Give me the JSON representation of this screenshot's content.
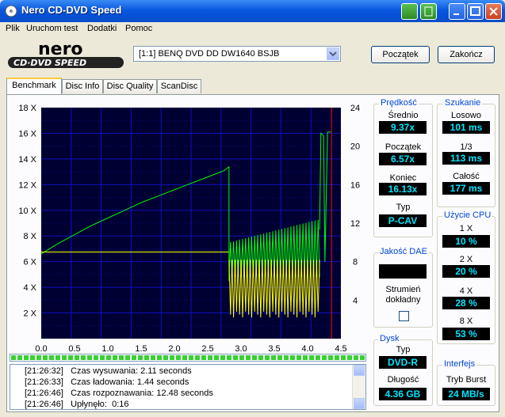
{
  "window": {
    "title": "Nero CD-DVD Speed"
  },
  "menu": [
    "Plik",
    "Uruchom test",
    "Dodatki",
    "Pomoc"
  ],
  "logo": {
    "brand": "nero",
    "sub": "CD·DVD SPEED"
  },
  "drive": {
    "selected": "[1:1]  BENQ DVD DD DW1640 BSJB"
  },
  "buttons": {
    "start": "Początek",
    "finish": "Zakończ"
  },
  "tabs": [
    "Benchmark",
    "Disc Info",
    "Disc Quality",
    "ScanDisc"
  ],
  "colors": {
    "plot_bg": "#000033",
    "grid": "#1010c0",
    "speed": "#00ff00",
    "rpm": "#ffff00",
    "marker": "#ff0000",
    "value_text": "#00e5ff"
  },
  "chart_data": {
    "type": "line",
    "x_ticks": [
      "0.0",
      "0.5",
      "1.0",
      "1.5",
      "2.0",
      "2.5",
      "3.0",
      "3.5",
      "4.0",
      "4.5"
    ],
    "y_left_ticks": [
      "18 X",
      "16 X",
      "14 X",
      "12 X",
      "10 X",
      "8 X",
      "6 X",
      "4 X",
      "2 X"
    ],
    "y_right_ticks": [
      "24",
      "20",
      "16",
      "12",
      "8",
      "4"
    ],
    "xlim": [
      0,
      4.5
    ],
    "ylim_left": [
      0,
      18
    ],
    "ylim_right": [
      0,
      24
    ],
    "marker_x": 4.36,
    "series": [
      {
        "color": "green",
        "axis": "left",
        "x": [
          0.0,
          0.25,
          0.5,
          0.75,
          1.0,
          1.25,
          1.5,
          1.75,
          2.0,
          2.25,
          2.5,
          2.75,
          2.82
        ],
        "y": [
          6.6,
          7.4,
          8.1,
          8.8,
          9.4,
          10.0,
          10.6,
          11.1,
          11.6,
          12.1,
          12.6,
          13.1,
          13.4
        ]
      },
      {
        "color": "yellow",
        "axis": "right",
        "x": [
          0.0,
          0.5,
          1.0,
          1.5,
          2.0,
          2.5,
          2.82
        ],
        "y": [
          9.0,
          9.0,
          9.0,
          9.0,
          9.0,
          9.0,
          9.0
        ]
      }
    ]
  },
  "log": [
    {
      "time": "[21:26:32]",
      "text": "Czas wysuwania: 2.11 seconds"
    },
    {
      "time": "[21:26:33]",
      "text": "Czas ładowania: 1.44 seconds"
    },
    {
      "time": "[21:26:46]",
      "text": "Czas rozpoznawania: 12.48 seconds"
    },
    {
      "time": "[21:26:46]",
      "text": "Upłynęło:  0:16"
    }
  ],
  "progress": 1.0,
  "speed": {
    "title": "Prędkość",
    "avg_label": "Średnio",
    "avg": "9.37x",
    "start_label": "Początek",
    "start": "6.57x",
    "end_label": "Koniec",
    "end": "16.13x",
    "type_label": "Typ",
    "type": "P-CAV"
  },
  "seek": {
    "title": "Szukanie",
    "random_label": "Losowo",
    "random": "101 ms",
    "third_label": "1/3",
    "third": "113 ms",
    "full_label": "Całość",
    "full": "177 ms"
  },
  "dae": {
    "title": "Jakość DAE",
    "stream_label": "Strumień dokładny"
  },
  "cpu": {
    "title": "Użycie CPU",
    "x1_label": "1 X",
    "x1": "10 %",
    "x2_label": "2 X",
    "x2": "20 %",
    "x4_label": "4 X",
    "x4": "28 %",
    "x8_label": "8 X",
    "x8": "53 %"
  },
  "disc": {
    "title": "Dysk",
    "type_label": "Typ",
    "type": "DVD-R",
    "length_label": "Długość",
    "length": "4.36 GB"
  },
  "interface": {
    "title": "Interfejs",
    "burst_label": "Tryb Burst",
    "burst": "24 MB/s"
  }
}
